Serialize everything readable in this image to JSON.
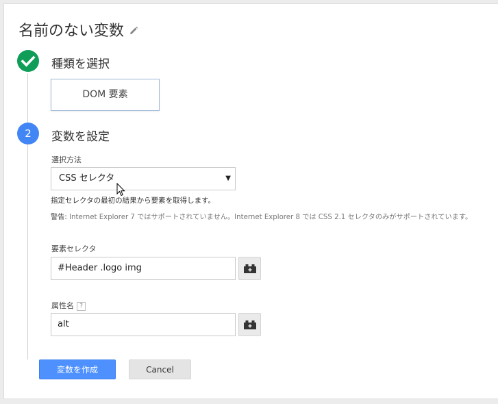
{
  "page": {
    "title": "名前のない変数"
  },
  "steps": [
    {
      "title": "種類を選択",
      "selected_type": "DOM 要素"
    },
    {
      "number": "2",
      "title": "変数を設定"
    }
  ],
  "form": {
    "method_label": "選択方法",
    "method_value": "CSS セレクタ",
    "method_help": "指定セレクタの最初の結果から要素を取得します。",
    "warning_label": "警告:",
    "warning_text": " Internet Explorer 7 ではサポートされていません。Internet Explorer 8 では CSS 2.1 セレクタのみがサポートされています。",
    "selector_label": "要素セレクタ",
    "selector_value": "#Header .logo img",
    "attribute_label": "属性名",
    "attribute_help": "?",
    "attribute_value": "alt"
  },
  "buttons": {
    "create": "変数を作成",
    "cancel": "Cancel"
  },
  "colors": {
    "check": "#0f9d58",
    "step": "#4285f4",
    "primary": "#4d90fe"
  },
  "icons": {
    "title_edit": "pencil-icon",
    "step1": "check-icon",
    "variable_picker": "brick-icon",
    "select_caret": "caret-down-icon",
    "pointer": "mouse-cursor-icon"
  }
}
